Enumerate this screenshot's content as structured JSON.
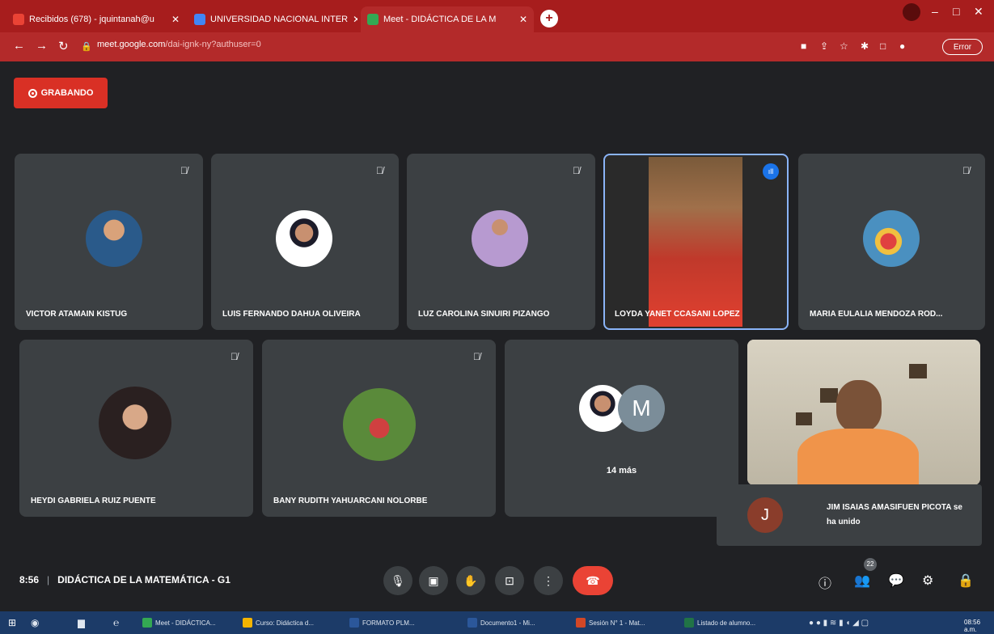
{
  "browser": {
    "tabs": [
      {
        "label": "Recibidos (678) - jquintanah@u",
        "fav_color": "#ea4335"
      },
      {
        "label": "UNIVERSIDAD NACIONAL INTER",
        "fav_color": "#4285f4"
      },
      {
        "label": "Meet - DIDÁCTICA DE LA M",
        "fav_color": "#34a853"
      }
    ],
    "new_tab_label": "+",
    "url_host": "meet.google.com",
    "url_path": "/dai-ignk-ny?authuser=0",
    "error_label": "Error",
    "window_controls": [
      "–",
      "□",
      "✕"
    ]
  },
  "meet": {
    "recording_label": "GRABANDO",
    "participants_top": [
      {
        "name": "VICTOR ATAMAIN KISTUG",
        "muted": true,
        "avatar_color": "#2a5a8a"
      },
      {
        "name": "LUIS FERNANDO DAHUA OLIVEIRA",
        "muted": true,
        "avatar_color": "#f2f2f2"
      },
      {
        "name": "LUZ CAROLINA SINUIRI PIZANGO",
        "muted": true,
        "avatar_color": "#9a7ab0"
      },
      {
        "name": "LOYDA YANET CCASANI LOPEZ",
        "muted": false,
        "speaking": true,
        "avatar_color": "#c0392b"
      },
      {
        "name": "MARIA EULALIA MENDOZA ROD...",
        "muted": true,
        "avatar_color": "#4a90c0"
      }
    ],
    "participants_bottom": [
      {
        "name": "HEYDI GABRIELA RUIZ PUENTE",
        "muted": true,
        "avatar_color": "#3a2a2a"
      },
      {
        "name": "BANY RUDITH YAHUARCANI NOLORBE",
        "muted": true,
        "avatar_color": "#3a7a3a"
      }
    ],
    "more_tile": {
      "initial": "M",
      "label": "14 más"
    },
    "notification": {
      "initial": "J",
      "text": "JIM ISAIAS AMASIFUEN PICOTA se ha unido"
    },
    "time": "8:56",
    "meeting_title": "DIDÁCTICA DE LA MATEMÁTICA - G1",
    "participant_count": "22"
  },
  "taskbar": {
    "items": [
      {
        "label": "Meet - DIDÁCTICA...",
        "color": "#34a853"
      },
      {
        "label": "Curso: Didáctica d...",
        "color": "#f4b400"
      },
      {
        "label": "FORMATO PLM...",
        "color": "#2b579a"
      },
      {
        "label": "Documento1 - Mi...",
        "color": "#2b579a"
      },
      {
        "label": "Sesión N° 1 - Mat...",
        "color": "#d24726"
      },
      {
        "label": "Listado de alumno...",
        "color": "#217346"
      }
    ],
    "clock": "08:56 a.m."
  }
}
